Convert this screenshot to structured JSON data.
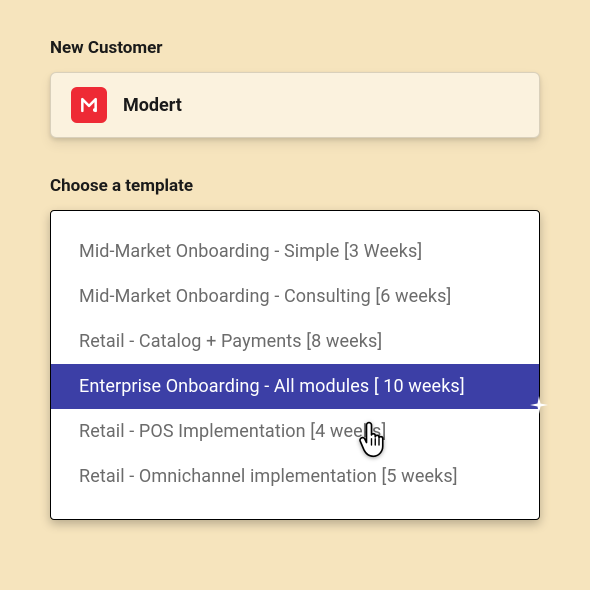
{
  "labels": {
    "newCustomer": "New Customer",
    "chooseTemplate": "Choose a template"
  },
  "customer": {
    "name": "Modert"
  },
  "templates": {
    "options": [
      "Mid-Market Onboarding - Simple [3 Weeks]",
      "Mid-Market Onboarding - Consulting [6 weeks]",
      "Retail - Catalog + Payments [8 weeks]",
      "Enterprise Onboarding - All modules [ 10 weeks]",
      "Retail - POS Implementation [4 weeks]",
      "Retail - Omnichannel implementation [5 weeks]"
    ],
    "selectedIndex": 3
  },
  "colors": {
    "background": "#f6e4bd",
    "cardBackground": "#fbf2de",
    "logoRed": "#ee2a35",
    "selectedPurple": "#3c3fa6",
    "textDark": "#1a1a1a",
    "textMuted": "#6b6b6b"
  }
}
